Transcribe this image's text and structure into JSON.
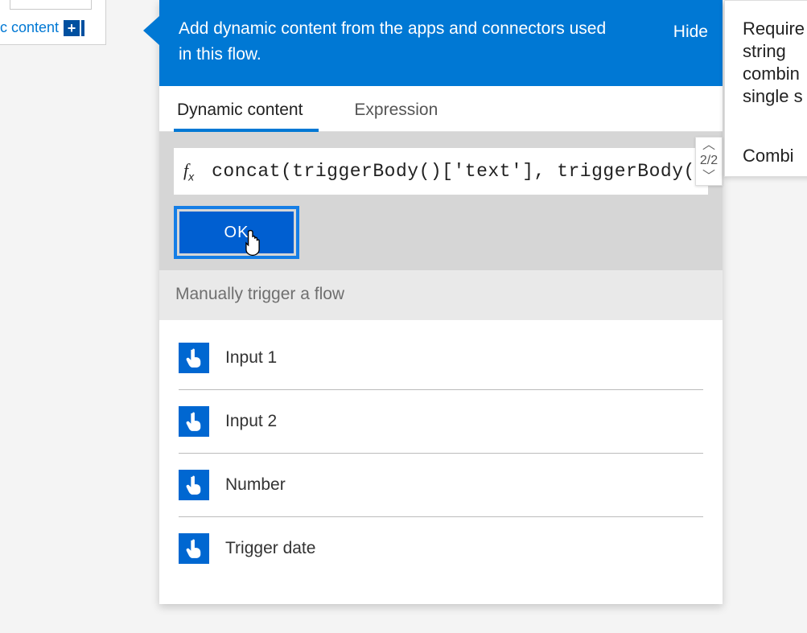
{
  "colors": {
    "primary": "#0078d4",
    "accent": "#005fd1"
  },
  "left_card": {
    "label_fragment": "c content"
  },
  "pager": {
    "text": "2/2"
  },
  "flyout": {
    "header_text": "Add dynamic content from the apps and connectors used in this flow.",
    "hide_label": "Hide",
    "tabs": {
      "dynamic": "Dynamic content",
      "expression": "Expression"
    },
    "expression_value": "concat(triggerBody()['text'], triggerBody(",
    "ok_label": "OK",
    "section_title": "Manually trigger a flow",
    "items": [
      {
        "label": "Input 1"
      },
      {
        "label": "Input 2"
      },
      {
        "label": "Number"
      },
      {
        "label": "Trigger date"
      }
    ]
  },
  "tooltip": {
    "line1": "Require",
    "line2": "string",
    "line3": "combin",
    "line4": "single s",
    "sub": "Combi"
  }
}
